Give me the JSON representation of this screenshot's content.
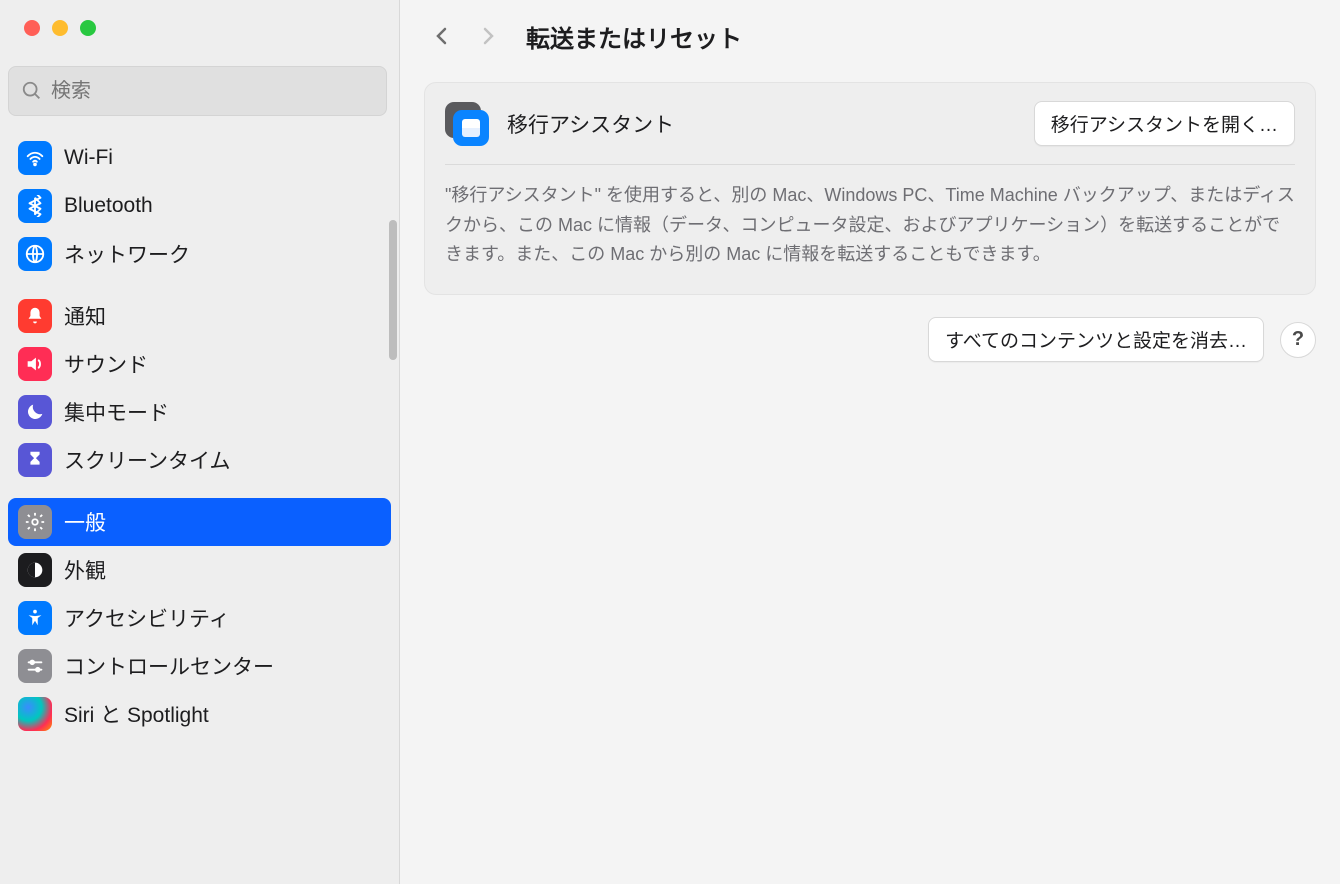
{
  "search": {
    "placeholder": "検索"
  },
  "sidebar": {
    "groups": [
      {
        "items": [
          {
            "label": "Wi-Fi"
          },
          {
            "label": "Bluetooth"
          },
          {
            "label": "ネットワーク"
          }
        ]
      },
      {
        "items": [
          {
            "label": "通知"
          },
          {
            "label": "サウンド"
          },
          {
            "label": "集中モード"
          },
          {
            "label": "スクリーンタイム"
          }
        ]
      },
      {
        "items": [
          {
            "label": "一般"
          },
          {
            "label": "外観"
          },
          {
            "label": "アクセシビリティ"
          },
          {
            "label": "コントロールセンター"
          },
          {
            "label": "Siri と Spotlight"
          }
        ]
      }
    ]
  },
  "header": {
    "title": "転送またはリセット"
  },
  "card": {
    "title": "移行アシスタント",
    "button": "移行アシスタントを開く…",
    "description": "\"移行アシスタント\" を使用すると、別の Mac、Windows PC、Time Machine バックアップ、またはディスクから、この Mac に情報（データ、コンピュータ設定、およびアプリケーション）を転送することができます。また、この Mac から別の Mac に情報を転送することもできます。"
  },
  "actions": {
    "erase": "すべてのコンテンツと設定を消去…",
    "help": "?"
  }
}
